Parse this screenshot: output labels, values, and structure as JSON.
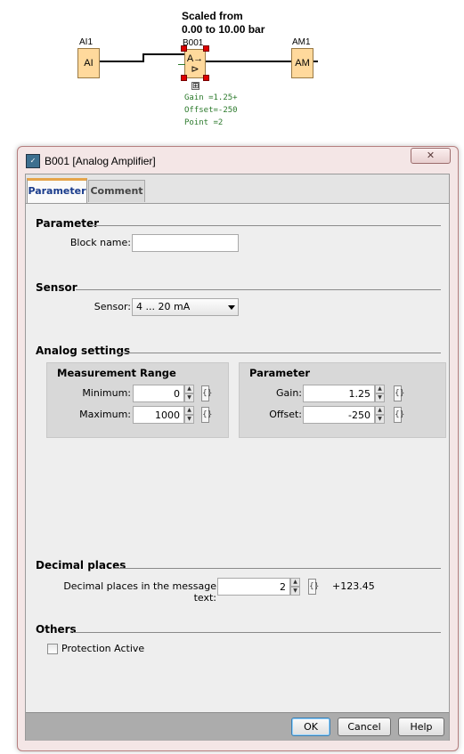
{
  "diagram": {
    "title_line1": "Scaled from",
    "title_line2": "0.00 to 10.00 bar",
    "blocks": {
      "ai_label": "AI1",
      "ai_text": "AI",
      "b001_label": "B001",
      "b001_text_top": "A→",
      "b001_text_bottom": "⊳",
      "am_label": "AM1",
      "am_text": "AM"
    },
    "params": {
      "gain": "Gain  =1.25+",
      "offset": "Offset=-250",
      "point": "Point =2"
    },
    "expand_symbol": "⊞"
  },
  "dialog": {
    "title": "B001 [Analog Amplifier]",
    "close_symbol": "✕",
    "tabs": [
      {
        "label": "Parameter"
      },
      {
        "label": "Comment"
      }
    ],
    "sections": {
      "parameter": {
        "title": "Parameter",
        "block_name_label": "Block name:",
        "block_name_value": ""
      },
      "sensor": {
        "title": "Sensor",
        "sensor_label": "Sensor:",
        "sensor_value": "4 ... 20 mA"
      },
      "analog": {
        "title": "Analog settings",
        "measurement": {
          "title": "Measurement Range",
          "minimum_label": "Minimum:",
          "minimum_value": "0",
          "maximum_label": "Maximum:",
          "maximum_value": "1000"
        },
        "parameter": {
          "title": "Parameter",
          "gain_label": "Gain:",
          "gain_value": "1.25",
          "offset_label": "Offset:",
          "offset_value": "-250"
        }
      },
      "decimal": {
        "title": "Decimal places",
        "label": "Decimal places in the message text:",
        "value": "2",
        "preview": "+123.45"
      },
      "others": {
        "title": "Others",
        "protection_label": "Protection Active",
        "protection_checked": false
      }
    },
    "buttons": {
      "ok": "OK",
      "cancel": "Cancel",
      "help": "Help"
    },
    "spin_up": "▲",
    "spin_down": "▼",
    "bracket_symbol": "{}"
  },
  "colors": {
    "block_fill": "#ffd99c",
    "handle": "#dd0000",
    "param_text": "#2c7a2c",
    "tab_accent": "#e6a44a",
    "dialog_frame": "#f4e6e6"
  }
}
